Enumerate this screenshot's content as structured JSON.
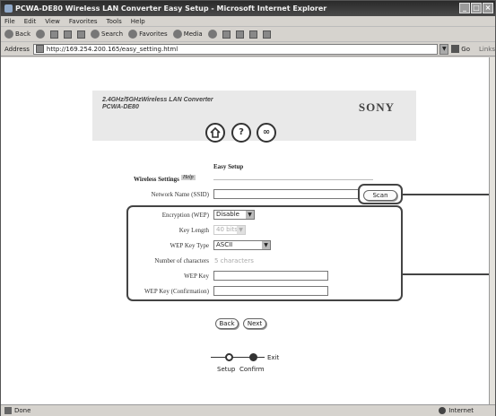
{
  "window": {
    "title": "PCWA-DE80 Wireless LAN Converter Easy Setup - Microsoft Internet Explorer"
  },
  "menu": [
    "File",
    "Edit",
    "View",
    "Favorites",
    "Tools",
    "Help"
  ],
  "toolbar": {
    "back": "Back",
    "search": "Search",
    "favorites": "Favorites",
    "media": "Media"
  },
  "address": {
    "label": "Address",
    "url": "http://169.254.200.165/easy_setting.html",
    "go": "Go",
    "links": "Links"
  },
  "header": {
    "product_line1": "2.4GHz/5GHzWireless LAN Converter",
    "product_line2": "PCWA-DE80",
    "brand": "SONY",
    "help_glyph": "?",
    "link_glyph": "∞"
  },
  "page": {
    "title": "Easy Setup",
    "section": "Wireless Settings",
    "help_badge": "Help"
  },
  "form": {
    "ssid_label": "Network Name (SSID)",
    "ssid_value": "",
    "scan_label": "Scan",
    "encryption_label": "Encryption (WEP)",
    "encryption_value": "Disable",
    "key_length_label": "Key Length",
    "key_length_value": "40 bits",
    "key_type_label": "WEP Key Type",
    "key_type_value": "ASCII",
    "num_chars_label": "Number of characters",
    "num_chars_value": "5 characters",
    "wep_key_label": "WEP Key",
    "wep_key_confirm_label": "WEP Key (Confirmation)"
  },
  "nav": {
    "back_label": "Back",
    "next_label": "Next"
  },
  "steps": {
    "exit_label": "Exit",
    "setup_label": "Setup",
    "confirm_label": "Confirm"
  },
  "status": {
    "left": "Done",
    "zone": "Internet"
  }
}
